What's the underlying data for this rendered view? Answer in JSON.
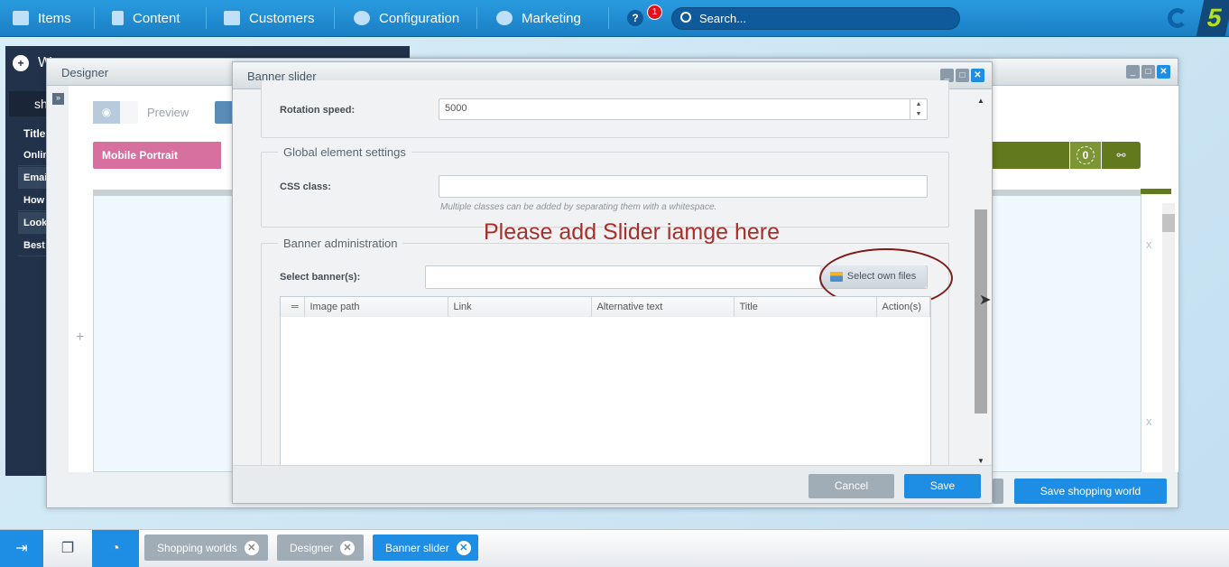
{
  "topbar": {
    "nav": [
      {
        "label": "Items",
        "icon": "inbox-icon"
      },
      {
        "label": "Content",
        "icon": "document-icon"
      },
      {
        "label": "Customers",
        "icon": "users-icon"
      },
      {
        "label": "Configuration",
        "icon": "gear-icon"
      },
      {
        "label": "Marketing",
        "icon": "pie-chart-icon"
      }
    ],
    "help_badge": "1",
    "search_placeholder": "Search...",
    "logo_text": "5"
  },
  "left_panel": {
    "header": "W",
    "tab": "sh",
    "items": [
      "Title",
      "Onlin",
      "Emai",
      "How",
      "Look",
      "Best"
    ]
  },
  "designer": {
    "title": "Designer",
    "preview_label": "Preview",
    "device_label": "Mobile Portrait",
    "count_badge": "0",
    "remove_marks": [
      "x",
      "x"
    ],
    "plus": "+",
    "save_button": "Save shopping world"
  },
  "banner_slider": {
    "title": "Banner slider",
    "rotation_label": "Rotation speed:",
    "rotation_value": "5000",
    "global_legend": "Global element settings",
    "css_label": "CSS class:",
    "css_value": "",
    "css_hint": "Multiple classes can be added by separating them with a whitespace.",
    "annotation": "Please add Slider iamge here",
    "banner_legend": "Banner administration",
    "select_label": "Select banner(s):",
    "select_value": "",
    "select_files_button": "Select own files",
    "columns": [
      "Image path",
      "Link",
      "Alternative text",
      "Title",
      "Action(s)"
    ],
    "cancel": "Cancel",
    "save": "Save"
  },
  "taskbar": {
    "tabs": [
      "Shopping worlds",
      "Designer",
      "Banner slider"
    ]
  },
  "colors": {
    "accent": "#1d8ee3",
    "mobile_portrait": "#d8709f",
    "green": "#62791e",
    "annotation": "#a8302a"
  }
}
